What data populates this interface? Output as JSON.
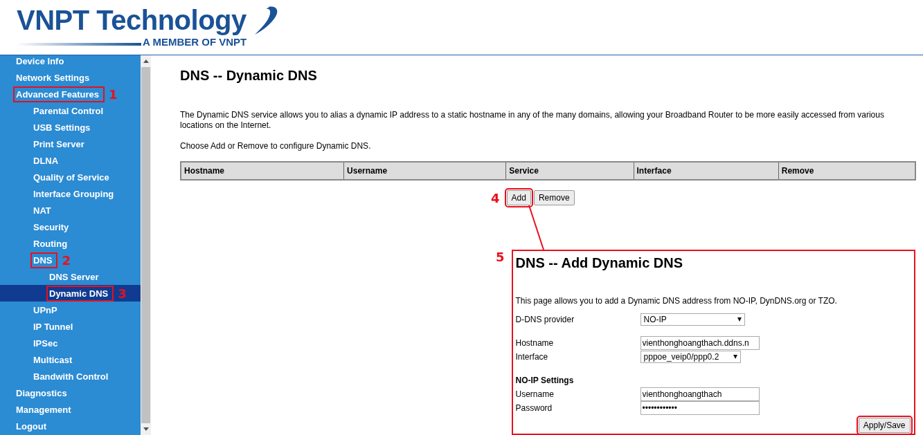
{
  "logo": {
    "name": "VNPT Technology",
    "tagline": "A MEMBER OF VNPT"
  },
  "sidebar": {
    "items": [
      {
        "label": "Device Info",
        "selected": false
      },
      {
        "label": "Network Settings",
        "selected": false
      },
      {
        "label": "Advanced Features",
        "selected": false,
        "callout": "1",
        "children": [
          {
            "label": "Parental Control",
            "selected": false
          },
          {
            "label": "USB Settings",
            "selected": false
          },
          {
            "label": "Print Server",
            "selected": false
          },
          {
            "label": "DLNA",
            "selected": false
          },
          {
            "label": "Quality of Service",
            "selected": false
          },
          {
            "label": "Interface Grouping",
            "selected": false
          },
          {
            "label": "NAT",
            "selected": false
          },
          {
            "label": "Security",
            "selected": false
          },
          {
            "label": "Routing",
            "selected": false
          },
          {
            "label": "DNS",
            "selected": false,
            "callout": "2",
            "children": [
              {
                "label": "DNS Server",
                "selected": false
              },
              {
                "label": "Dynamic DNS",
                "selected": true,
                "callout": "3"
              }
            ]
          },
          {
            "label": "UPnP",
            "selected": false
          },
          {
            "label": "IP Tunnel",
            "selected": false
          },
          {
            "label": "IPSec",
            "selected": false
          },
          {
            "label": "Multicast",
            "selected": false
          },
          {
            "label": "Bandwith Control",
            "selected": false
          }
        ]
      },
      {
        "label": "Diagnostics",
        "selected": false
      },
      {
        "label": "Management",
        "selected": false
      },
      {
        "label": "Logout",
        "selected": false
      }
    ]
  },
  "page": {
    "title": "DNS -- Dynamic DNS",
    "description": "The Dynamic DNS service allows you to alias a dynamic IP address to a static hostname in any of the many domains, allowing your Broadband Router to be more easily accessed from various locations on the Internet.",
    "instruction": "Choose Add or Remove to configure Dynamic DNS.",
    "table": {
      "columns": [
        "Hostname",
        "Username",
        "Service",
        "Interface",
        "Remove"
      ]
    },
    "buttons": [
      {
        "label": "Add",
        "callout": "4"
      },
      {
        "label": "Remove"
      }
    ]
  },
  "add_panel": {
    "callout": "5",
    "title": "DNS -- Add Dynamic DNS",
    "description": "This page allows you to add a Dynamic DNS address from NO-IP, DynDNS.org or TZO.",
    "fields": [
      {
        "kind": "select",
        "label": "D-DNS provider",
        "value": "NO-IP"
      },
      {
        "kind": "text",
        "label": "Hostname",
        "value": "vienthonghoangthach.ddns.n"
      },
      {
        "kind": "select",
        "label": "Interface",
        "value": "pppoe_veip0/ppp0.2"
      },
      {
        "kind": "heading",
        "label": "NO-IP Settings"
      },
      {
        "kind": "text",
        "label": "Username",
        "value": "vienthonghoangthach"
      },
      {
        "kind": "text",
        "label": "Password",
        "value": "••••••••••••"
      }
    ],
    "submit": {
      "label": "Apply/Save",
      "highlighted": true
    }
  }
}
